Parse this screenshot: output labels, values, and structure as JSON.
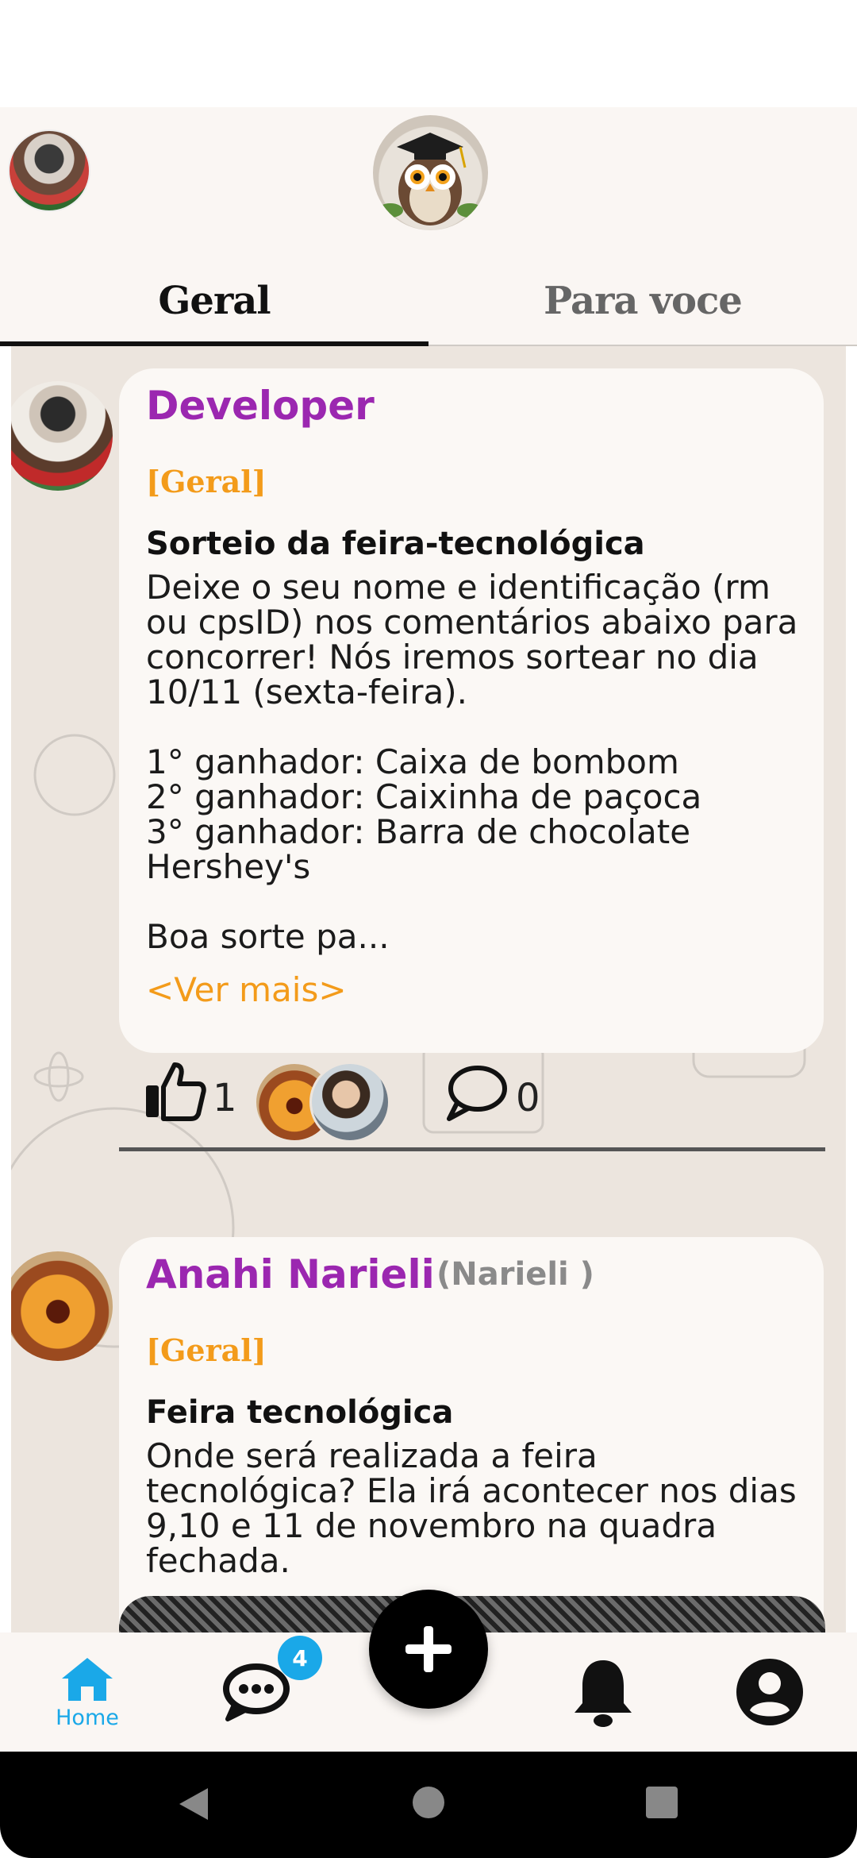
{
  "header": {
    "tabs": [
      {
        "label": "Geral",
        "active": true
      },
      {
        "label": "Para voce",
        "active": false
      }
    ]
  },
  "posts": [
    {
      "author": "Developer",
      "nickname": "",
      "category": "[Geral]",
      "title": "Sorteio da feira-tecnológica",
      "body": "Deixe o seu nome e identificação (rm ou cpsID) nos comentários abaixo para concorrer! Nós iremos sortear no dia 10/11 (sexta-feira).\n\n1° ganhador: Caixa de bombom\n2° ganhador: Caixinha de paçoca\n3° ganhador: Barra de chocolate Hershey's\n\nBoa sorte pa...",
      "see_more": "<Ver mais>",
      "likes": "1",
      "comments": "0"
    },
    {
      "author": "Anahi Narieli",
      "nickname": "(Narieli )",
      "category": "[Geral]",
      "title": "Feira tecnológica",
      "body": "Onde será realizada a feira tecnológica? Ela irá acontecer nos dias 9,10 e 11 de novembro na quadra fechada."
    }
  ],
  "bottom_nav": {
    "home_label": "Home",
    "chat_badge": "4",
    "icons": [
      "home-icon",
      "chat-icon",
      "add-icon",
      "bell-icon",
      "account-icon"
    ]
  },
  "colors": {
    "accent": "#1aa8e8",
    "author": "#9b27b0",
    "category": "#f39b1a"
  }
}
